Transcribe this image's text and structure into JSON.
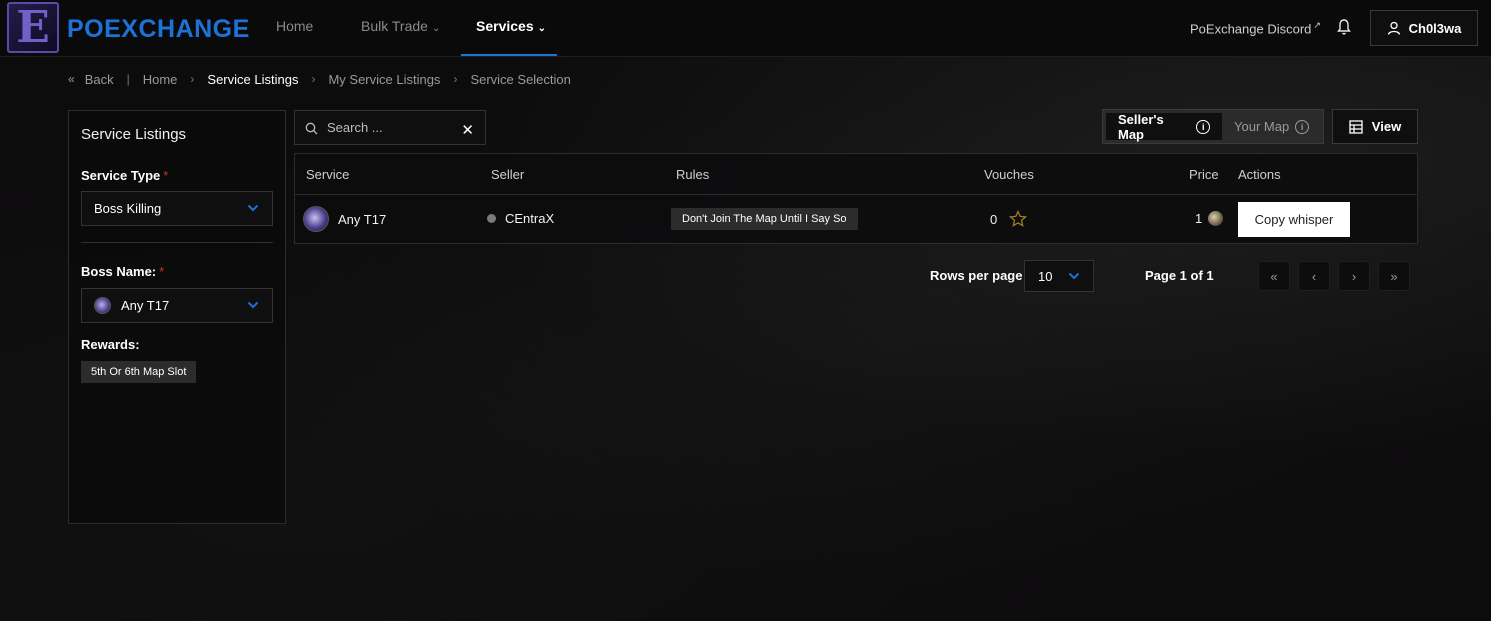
{
  "brand": {
    "logo_letter": "E",
    "name": "POEXCHANGE",
    "accent": "#1d72d8"
  },
  "nav": {
    "home": "Home",
    "bulk_trade": "Bulk Trade",
    "services": "Services",
    "discord": "PoExchange Discord",
    "username": "Ch0l3wa"
  },
  "breadcrumb": {
    "back": "Back",
    "home": "Home",
    "service_listings": "Service Listings",
    "my_service_listings": "My Service Listings",
    "service_selection": "Service Selection"
  },
  "sidebar": {
    "title": "Service Listings",
    "service_type_label": "Service Type",
    "service_type_value": "Boss Killing",
    "boss_name_label": "Boss Name:",
    "boss_name_value": "Any T17",
    "rewards_label": "Rewards:",
    "reward_tag": "5th Or 6th Map Slot",
    "required_mark": "*"
  },
  "search": {
    "placeholder": "Search ..."
  },
  "map_toggle": {
    "sellers_map": "Seller's Map",
    "your_map": "Your Map",
    "info_glyph": "i"
  },
  "view_button": "View",
  "table": {
    "headers": [
      "Service",
      "Seller",
      "Rules",
      "Vouches",
      "Price",
      "Actions"
    ],
    "rows": [
      {
        "service": "Any T17",
        "seller": "CEntraX",
        "seller_status": "offline",
        "rule": "Don't Join The Map Until I Say So",
        "vouches": "0",
        "price": "1",
        "action": "Copy whisper"
      }
    ]
  },
  "pagination": {
    "rows_per_page_label": "Rows per page",
    "rows_per_page_value": "10",
    "page_info": "Page 1 of 1",
    "first": "«",
    "prev": "‹",
    "next": "›",
    "last": "»"
  }
}
